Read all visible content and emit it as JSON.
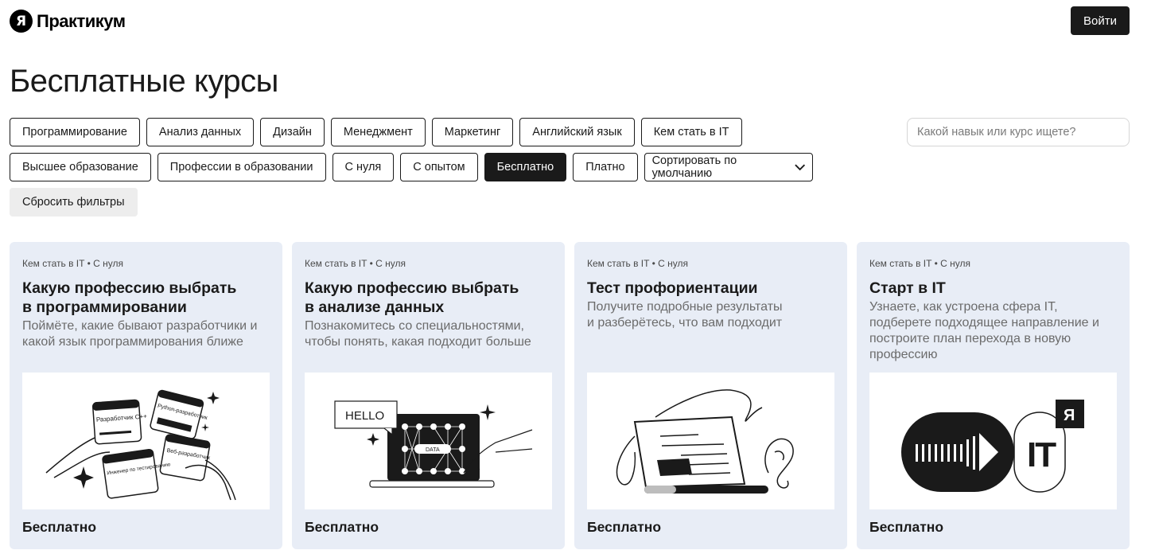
{
  "header": {
    "logo_mark": "Я",
    "logo_text": "Практикум",
    "login_label": "Войти"
  },
  "page_title": "Бесплатные курсы",
  "search": {
    "placeholder": "Какой навык или курс ищете?",
    "value": ""
  },
  "filters": {
    "row1": [
      "Программирование",
      "Анализ данных",
      "Дизайн",
      "Менеджмент",
      "Маркетинг",
      "Английский язык",
      "Кем стать в IT"
    ],
    "row2": [
      "Высшее образование",
      "Профессии в образовании",
      "С нуля",
      "С опытом",
      "Бесплатно",
      "Платно"
    ],
    "active": "Бесплатно",
    "sort_label": "Сортировать по умолчанию",
    "reset_label": "Сбросить фильтры"
  },
  "cards": [
    {
      "tags": "Кем стать в IT • С нуля",
      "title": "Какую профессию выбрать\nв программировании",
      "description": "Поймёте, какие бывают разработчики и\nкакой язык программирования ближе",
      "image_texts": [
        "Разработчик C++",
        "Python-разработчик",
        "Веб-разработчик",
        "Инженер по тестированию"
      ],
      "price": "Бесплатно"
    },
    {
      "tags": "Кем стать в IT • С нуля",
      "title": "Какую профессию выбрать\nв анализе данных",
      "description": "Познакомитесь со специальностями,\nчтобы понять, какая подходит больше",
      "image_texts": [
        "HELLO",
        "DATA"
      ],
      "price": "Бесплатно"
    },
    {
      "tags": "Кем стать в IT • С нуля",
      "title": "Тест профориентации",
      "description": "Получите подробные результаты\nи разберётесь, что вам подходит",
      "image_texts": [],
      "price": "Бесплатно"
    },
    {
      "tags": "Кем стать в IT • С нуля",
      "title": "Старт в IT",
      "description": "Узнаете, как устроена сфера IT,\nподберете подходящее направление и\nпостроите план перехода в новую\nпрофессию",
      "image_texts": [
        "IT",
        "Я"
      ],
      "price": "Бесплатно"
    }
  ],
  "colors": {
    "card_bg": "#e8edf6",
    "dark": "#1a1a1a",
    "muted_text": "#6b6b6b",
    "reset_bg": "#ededed"
  }
}
